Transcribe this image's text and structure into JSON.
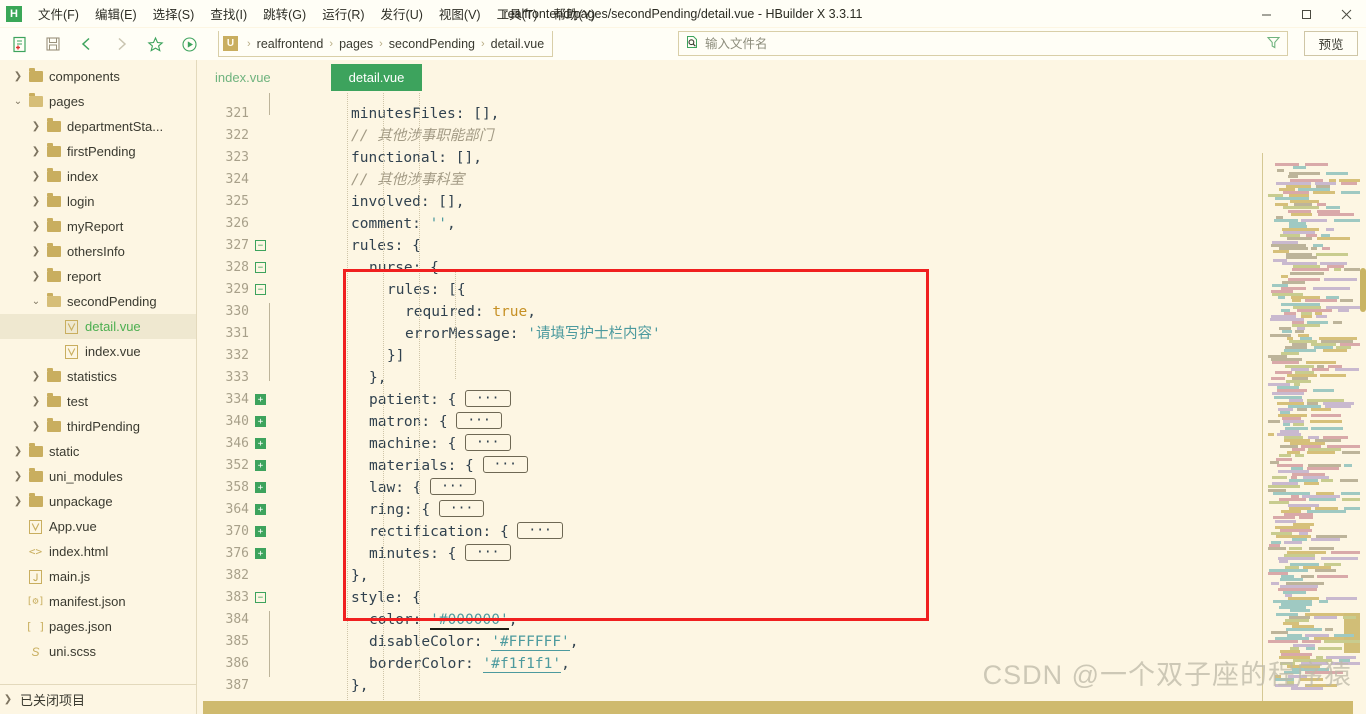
{
  "window": {
    "title": "realfrontend/pages/secondPending/detail.vue - HBuilder X 3.3.11",
    "logo_text": "H",
    "minimize_label": "—",
    "maximize_label": "❐",
    "close_label": "✕"
  },
  "menubar": {
    "items": [
      {
        "label": "文件(F)",
        "name": "menu-file"
      },
      {
        "label": "编辑(E)",
        "name": "menu-edit"
      },
      {
        "label": "选择(S)",
        "name": "menu-select"
      },
      {
        "label": "查找(I)",
        "name": "menu-find"
      },
      {
        "label": "跳转(G)",
        "name": "menu-goto"
      },
      {
        "label": "运行(R)",
        "name": "menu-run"
      },
      {
        "label": "发行(U)",
        "name": "menu-publish"
      },
      {
        "label": "视图(V)",
        "name": "menu-view"
      },
      {
        "label": "工具(T)",
        "name": "menu-tools"
      },
      {
        "label": "帮助(Y)",
        "name": "menu-help"
      }
    ]
  },
  "toolbar": {
    "icons": [
      {
        "name": "new-file-icon"
      },
      {
        "name": "save-icon"
      },
      {
        "name": "back-arrow-icon"
      },
      {
        "name": "forward-arrow-icon"
      },
      {
        "name": "star-icon"
      },
      {
        "name": "run-icon"
      }
    ],
    "breadcrumb": {
      "badge": "U",
      "separator": "›",
      "segments": [
        "realfrontend",
        "pages",
        "secondPending",
        "detail.vue"
      ]
    },
    "filename_placeholder": "输入文件名",
    "filename_value": "",
    "filter_icon": "filter-icon",
    "preview_label": "预览"
  },
  "sidebar": {
    "tree": [
      {
        "label": "components",
        "depth": 1,
        "type": "folder",
        "state": "collapsed"
      },
      {
        "label": "pages",
        "depth": 1,
        "type": "folder",
        "state": "expanded"
      },
      {
        "label": "departmentSta...",
        "depth": 2,
        "type": "folder",
        "state": "collapsed"
      },
      {
        "label": "firstPending",
        "depth": 2,
        "type": "folder",
        "state": "collapsed"
      },
      {
        "label": "index",
        "depth": 2,
        "type": "folder",
        "state": "collapsed"
      },
      {
        "label": "login",
        "depth": 2,
        "type": "folder",
        "state": "collapsed"
      },
      {
        "label": "myReport",
        "depth": 2,
        "type": "folder",
        "state": "collapsed"
      },
      {
        "label": "othersInfo",
        "depth": 2,
        "type": "folder",
        "state": "collapsed"
      },
      {
        "label": "report",
        "depth": 2,
        "type": "folder",
        "state": "collapsed"
      },
      {
        "label": "secondPending",
        "depth": 2,
        "type": "folder",
        "state": "expanded"
      },
      {
        "label": "detail.vue",
        "depth": 3,
        "type": "vue",
        "state": "selected"
      },
      {
        "label": "index.vue",
        "depth": 3,
        "type": "vue",
        "state": "none"
      },
      {
        "label": "statistics",
        "depth": 2,
        "type": "folder",
        "state": "collapsed"
      },
      {
        "label": "test",
        "depth": 2,
        "type": "folder",
        "state": "collapsed"
      },
      {
        "label": "thirdPending",
        "depth": 2,
        "type": "folder",
        "state": "collapsed"
      },
      {
        "label": "static",
        "depth": 1,
        "type": "folder",
        "state": "collapsed"
      },
      {
        "label": "uni_modules",
        "depth": 1,
        "type": "folder",
        "state": "collapsed"
      },
      {
        "label": "unpackage",
        "depth": 1,
        "type": "folder",
        "state": "collapsed"
      },
      {
        "label": "App.vue",
        "depth": 1,
        "type": "vue",
        "state": "none"
      },
      {
        "label": "index.html",
        "depth": 1,
        "type": "html",
        "state": "none"
      },
      {
        "label": "main.js",
        "depth": 1,
        "type": "js",
        "state": "none"
      },
      {
        "label": "manifest.json",
        "depth": 1,
        "type": "manifest",
        "state": "none"
      },
      {
        "label": "pages.json",
        "depth": 1,
        "type": "json",
        "state": "none"
      },
      {
        "label": "uni.scss",
        "depth": 1,
        "type": "scss",
        "state": "none"
      }
    ],
    "closed_projects_label": "已关闭项目"
  },
  "editor": {
    "tabs": [
      {
        "label": "index.vue",
        "active": false
      },
      {
        "label": "detail.vue",
        "active": true
      }
    ],
    "lines": [
      {
        "num": "321",
        "fold": "none",
        "indent": 3,
        "tokens": [
          {
            "t": "plain",
            "v": "minutesFiles: [],"
          }
        ]
      },
      {
        "num": "322",
        "fold": "none",
        "indent": 3,
        "tokens": [
          {
            "t": "comment",
            "v": "// 其他涉事职能部门"
          }
        ]
      },
      {
        "num": "323",
        "fold": "none",
        "indent": 3,
        "tokens": [
          {
            "t": "plain",
            "v": "functional: [],"
          }
        ]
      },
      {
        "num": "324",
        "fold": "none",
        "indent": 3,
        "tokens": [
          {
            "t": "comment",
            "v": "// 其他涉事科室"
          }
        ]
      },
      {
        "num": "325",
        "fold": "none",
        "indent": 3,
        "tokens": [
          {
            "t": "plain",
            "v": "involved: [],"
          }
        ]
      },
      {
        "num": "326",
        "fold": "none",
        "indent": 3,
        "tokens": [
          {
            "t": "plain",
            "v": "comment: "
          },
          {
            "t": "str",
            "v": "''"
          },
          {
            "t": "plain",
            "v": ","
          }
        ]
      },
      {
        "num": "327",
        "fold": "open",
        "indent": 3,
        "tokens": [
          {
            "t": "plain",
            "v": "rules: {"
          }
        ]
      },
      {
        "num": "328",
        "fold": "open",
        "indent": 4,
        "tokens": [
          {
            "t": "plain",
            "v": "nurse: {"
          }
        ]
      },
      {
        "num": "329",
        "fold": "open",
        "indent": 5,
        "tokens": [
          {
            "t": "plain",
            "v": "rules: [{"
          }
        ]
      },
      {
        "num": "330",
        "fold": "none",
        "indent": 6,
        "tokens": [
          {
            "t": "plain",
            "v": "required: "
          },
          {
            "t": "bool",
            "v": "true"
          },
          {
            "t": "plain",
            "v": ","
          }
        ]
      },
      {
        "num": "331",
        "fold": "none",
        "indent": 6,
        "tokens": [
          {
            "t": "plain",
            "v": "errorMessage: "
          },
          {
            "t": "str",
            "v": "'请填写护士栏内容'"
          }
        ]
      },
      {
        "num": "332",
        "fold": "none",
        "indent": 5,
        "tokens": [
          {
            "t": "plain",
            "v": "}]"
          }
        ]
      },
      {
        "num": "333",
        "fold": "none",
        "indent": 4,
        "tokens": [
          {
            "t": "plain",
            "v": "},"
          }
        ]
      },
      {
        "num": "334",
        "fold": "collapsed",
        "indent": 4,
        "tokens": [
          {
            "t": "plain",
            "v": "patient: { "
          },
          {
            "t": "ellipsis",
            "v": "···"
          }
        ]
      },
      {
        "num": "340",
        "fold": "collapsed",
        "indent": 4,
        "tokens": [
          {
            "t": "plain",
            "v": "matron: { "
          },
          {
            "t": "ellipsis",
            "v": "···"
          }
        ]
      },
      {
        "num": "346",
        "fold": "collapsed",
        "indent": 4,
        "tokens": [
          {
            "t": "plain",
            "v": "machine: { "
          },
          {
            "t": "ellipsis",
            "v": "···"
          }
        ]
      },
      {
        "num": "352",
        "fold": "collapsed",
        "indent": 4,
        "tokens": [
          {
            "t": "plain",
            "v": "materials: { "
          },
          {
            "t": "ellipsis",
            "v": "···"
          }
        ]
      },
      {
        "num": "358",
        "fold": "collapsed",
        "indent": 4,
        "tokens": [
          {
            "t": "plain",
            "v": "law: { "
          },
          {
            "t": "ellipsis",
            "v": "···"
          }
        ]
      },
      {
        "num": "364",
        "fold": "collapsed",
        "indent": 4,
        "tokens": [
          {
            "t": "plain",
            "v": "ring: { "
          },
          {
            "t": "ellipsis",
            "v": "···"
          }
        ]
      },
      {
        "num": "370",
        "fold": "collapsed",
        "indent": 4,
        "tokens": [
          {
            "t": "plain",
            "v": "rectification: { "
          },
          {
            "t": "ellipsis",
            "v": "···"
          }
        ]
      },
      {
        "num": "376",
        "fold": "collapsed",
        "indent": 4,
        "tokens": [
          {
            "t": "plain",
            "v": "minutes: { "
          },
          {
            "t": "ellipsis",
            "v": "···"
          }
        ]
      },
      {
        "num": "382",
        "fold": "none",
        "indent": 3,
        "tokens": [
          {
            "t": "plain",
            "v": "},"
          }
        ]
      },
      {
        "num": "383",
        "fold": "open",
        "indent": 3,
        "tokens": [
          {
            "t": "plain",
            "v": "style: {"
          }
        ]
      },
      {
        "num": "384",
        "fold": "none",
        "indent": 4,
        "tokens": [
          {
            "t": "plain",
            "v": "color: "
          },
          {
            "t": "str-blk",
            "v": "'#000000'"
          },
          {
            "t": "plain",
            "v": ","
          }
        ]
      },
      {
        "num": "385",
        "fold": "none",
        "indent": 4,
        "tokens": [
          {
            "t": "plain",
            "v": "disableColor: "
          },
          {
            "t": "str-u",
            "v": "'#FFFFFF'"
          },
          {
            "t": "plain",
            "v": ","
          }
        ]
      },
      {
        "num": "386",
        "fold": "none",
        "indent": 4,
        "tokens": [
          {
            "t": "plain",
            "v": "borderColor: "
          },
          {
            "t": "str-u",
            "v": "'#f1f1f1'"
          },
          {
            "t": "plain",
            "v": ","
          }
        ]
      },
      {
        "num": "387",
        "fold": "none",
        "indent": 3,
        "tokens": [
          {
            "t": "plain",
            "v": "},"
          }
        ]
      }
    ],
    "highlight_box": {
      "label": "rules-block-highlight",
      "color": "#F01F1F"
    }
  },
  "watermark": {
    "text": "CSDN @一个双子座的程序猿"
  },
  "colors": {
    "background": "#FDF6E3",
    "accent_green": "#3DA35D",
    "folder_gold": "#C9AE5F",
    "string_teal": "#4C9A9E",
    "bool_orange": "#C69024",
    "highlight_red": "#F01F1F"
  }
}
